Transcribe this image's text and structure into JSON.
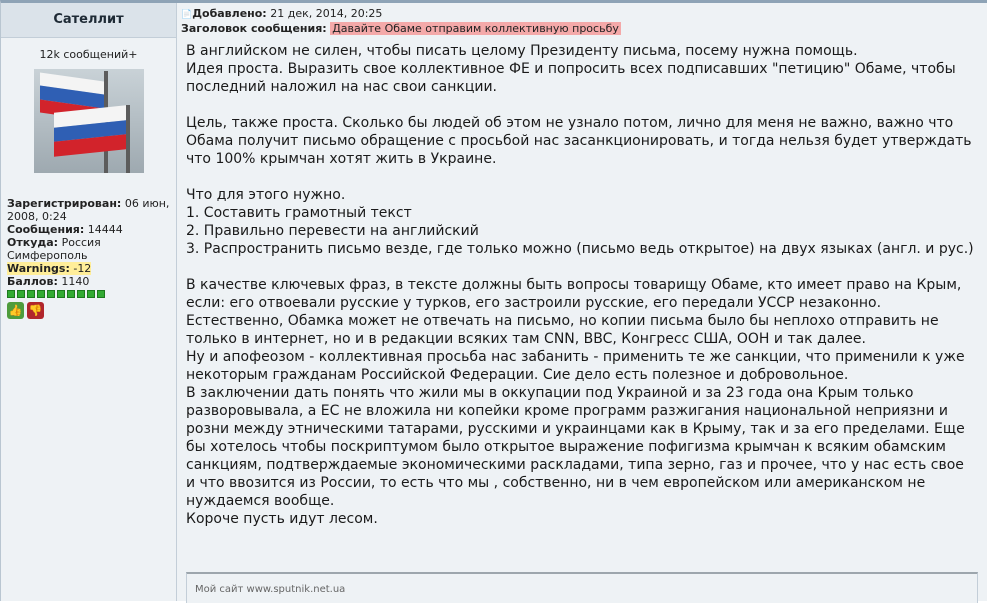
{
  "user": {
    "name": "Сателлит",
    "msgcount": "12k сообщений+",
    "fields": [
      {
        "label": "Зарегистрирован:",
        "value": "06 июн, 2008, 0:24"
      },
      {
        "label": "Сообщения:",
        "value": "14444"
      },
      {
        "label": "Откуда:",
        "value": "Россия Симферополь"
      },
      {
        "label": "Warnings:",
        "value": "-12"
      },
      {
        "label": "Баллов:",
        "value": "1140"
      }
    ],
    "reputation_blocks": 10,
    "icons": [
      "thumbs-up-icon",
      "thumbs-down-icon"
    ]
  },
  "post": {
    "added_label": "Добавлено:",
    "added_value": "21 дек, 2014, 20:25",
    "subject_label": "Заголовок сообщения:",
    "subject_value": "Давайте Обаме отправим коллективную просьбу",
    "paragraphs": [
      "В английском не силен, чтобы писать целому Президенту письма, посему нужна помощь.",
      "Идея проста. Выразить свое коллективное ФЕ и попросить всех подписавших \"петицию\" Обаме, чтобы последний наложил на нас свои санкции.",
      "",
      "Цель, также проста. Сколько бы людей об этом не узнало потом, лично для меня не важно, важно что Обама получит письмо обращение с просьбой нас засанкционировать, и тогда нельзя будет утверждать что 100% крымчан хотят жить в Украине.",
      "",
      "Что для этого нужно.",
      "1. Составить грамотный текст",
      "2. Правильно перевести на английский",
      "3. Распространить письмо везде, где только можно (письмо ведь открытое) на двух языках (англ. и рус.)",
      "",
      "В качестве ключевых фраз, в тексте должны быть вопросы товарищу Обаме, кто имеет право на Крым, если: его отвоевали русские у турков, его застроили русские, его передали УССР незаконно.",
      "Естественно, Обамка может не отвечать на письмо, но копии письма было бы неплохо отправить не только в интернет, но и в редакции всяких там CNN, BBC, Конгресс США, ООН и так далее.",
      "Ну и апофеозом - коллективная просьба нас забанить - применить те же санкции, что применили к уже некоторым гражданам Российской Федерации. Сие дело есть полезное и добровольное.",
      "В заключении дать понять что жили мы в оккупации под Украиной и за 23 года она Крым только разворовывала, а ЕС не вложила ни копейки кроме программ разжигания национальной неприязни и розни между этническими татарами, русскими и украинцами как в Крыму, так и за его пределами. Еще бы хотелось чтобы поскриптумом было открытое выражение пофигизма крымчан к всяким обамским санкциям, подтверждаемые экономическими раскладами, типа зерно, газ и прочее, что у нас есть свое и что ввозится из России, то есть что мы , собственно, ни в чем европейском или американском не нуждаемся вообще.",
      "Короче пусть идут лесом."
    ],
    "signature": "Мой сайт www.sputnik.net.ua"
  }
}
